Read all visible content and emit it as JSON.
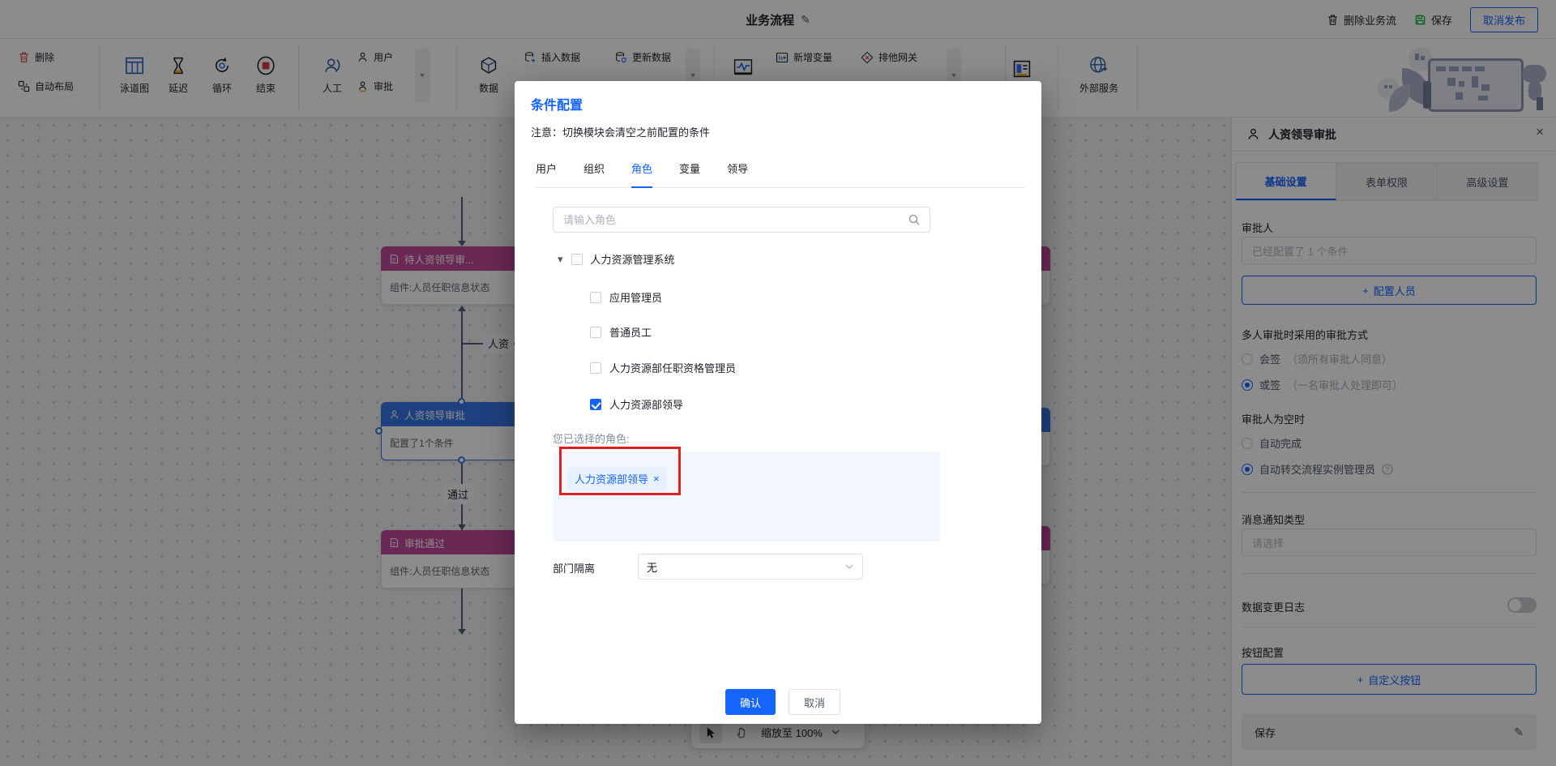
{
  "header": {
    "title": "业务流程",
    "delete_flow": "删除业务流",
    "save": "保存",
    "unpublish": "取消发布"
  },
  "toolbar": {
    "delete": "删除",
    "auto_layout": "自动布局",
    "swimlane": "泳道图",
    "delay": "延迟",
    "loop": "循环",
    "end": "结束",
    "manual": "人工",
    "user": "用户",
    "approve": "审批",
    "data": "数据",
    "insert_data": "插入数据",
    "update_data": "更新数据",
    "add_variable": "新增变量",
    "exclusive_gateway": "排他网关",
    "external_service": "外部服务"
  },
  "canvas": {
    "nodes": [
      {
        "title": "待人资领导审...",
        "subtitle": "组件:人员任职信息状态"
      },
      {
        "title": "人资领导审批",
        "subtitle": "配置了1个条件"
      },
      {
        "title": "审批通过",
        "subtitle": "组件:人员任职信息状态"
      }
    ],
    "edge_labels": {
      "renzi": "人资",
      "pass": "通过"
    },
    "zoombar": {
      "zoom_label": "缩放至 100%"
    }
  },
  "modal": {
    "title": "条件配置",
    "note": "注意：切换模块会清空之前配置的条件",
    "tabs": [
      {
        "label": "用户",
        "active": false
      },
      {
        "label": "组织",
        "active": false
      },
      {
        "label": "角色",
        "active": true
      },
      {
        "label": "变量",
        "active": false
      },
      {
        "label": "领导",
        "active": false
      }
    ],
    "search_placeholder": "请输入角色",
    "tree": {
      "root": "人力资源管理系统",
      "children": [
        {
          "label": "应用管理员",
          "checked": false
        },
        {
          "label": "普通员工",
          "checked": false
        },
        {
          "label": "人力资源部任职资格管理员",
          "checked": false
        },
        {
          "label": "人力资源部领导",
          "checked": true
        }
      ]
    },
    "selected_label": "您已选择的角色:",
    "selected_tag": "人力资源部领导",
    "dept_isolation_label": "部门隔离",
    "dept_isolation_value": "无",
    "confirm": "确认",
    "cancel": "取消"
  },
  "panel": {
    "title": "人资领导审批",
    "tabs": [
      {
        "label": "基础设置",
        "active": true
      },
      {
        "label": "表单权限",
        "active": false
      },
      {
        "label": "高级设置",
        "active": false
      }
    ],
    "approver_label": "审批人",
    "approver_value": "已经配置了 1 个条件",
    "add_person": "配置人员",
    "multi_label": "多人审批时采用的审批方式",
    "sign_all": "会签",
    "sign_all_hint": "（须所有审批人同意）",
    "sign_any": "或签",
    "sign_any_hint": "（一名审批人处理即可）",
    "empty_label": "审批人为空时",
    "auto_complete": "自动完成",
    "auto_transfer": "自动转交流程实例管理员",
    "notify_label": "消息通知类型",
    "notify_placeholder": "请选择",
    "log_label": "数据变更日志",
    "button_config_label": "按钮配置",
    "custom_button": "自定义按钮",
    "save_row": "保存"
  },
  "glyphs": {
    "pencil": "✎",
    "close": "×",
    "caret": "▾",
    "scroll": "▾",
    "tag_close": "×",
    "plus": "+"
  },
  "colors": {
    "primary": "#1664ff",
    "annotation_red": "#e02020",
    "node_purple": "#c14a9a",
    "node_blue": "#3a76e8",
    "save_green": "#00b42a"
  },
  "icons": [
    "trash-icon",
    "auto-layout-icon",
    "swimlane-icon",
    "delay-icon",
    "loop-icon",
    "end-icon",
    "manual-icon",
    "user-icon",
    "approve-icon",
    "data-icon",
    "insert-data-icon",
    "update-data-icon",
    "waveform-icon",
    "add-variable-icon",
    "exclusive-gateway-icon",
    "form-icon",
    "external-service-icon",
    "search-icon",
    "close-icon",
    "pencil-icon",
    "save-icon",
    "person-icon",
    "document-icon",
    "question-icon",
    "cursor-icon",
    "hand-icon",
    "chevron-down-icon",
    "caret-down-icon"
  ]
}
